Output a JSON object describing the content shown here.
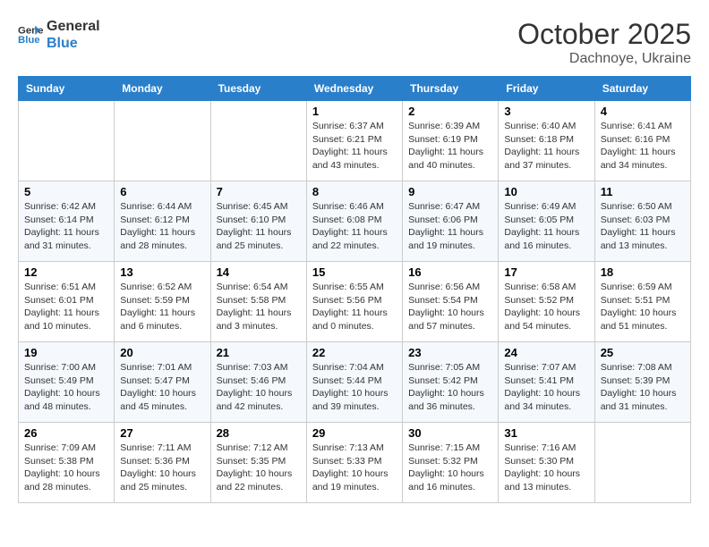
{
  "header": {
    "logo_line1": "General",
    "logo_line2": "Blue",
    "month": "October 2025",
    "location": "Dachnoye, Ukraine"
  },
  "weekdays": [
    "Sunday",
    "Monday",
    "Tuesday",
    "Wednesday",
    "Thursday",
    "Friday",
    "Saturday"
  ],
  "weeks": [
    [
      {
        "day": "",
        "info": ""
      },
      {
        "day": "",
        "info": ""
      },
      {
        "day": "",
        "info": ""
      },
      {
        "day": "1",
        "info": "Sunrise: 6:37 AM\nSunset: 6:21 PM\nDaylight: 11 hours\nand 43 minutes."
      },
      {
        "day": "2",
        "info": "Sunrise: 6:39 AM\nSunset: 6:19 PM\nDaylight: 11 hours\nand 40 minutes."
      },
      {
        "day": "3",
        "info": "Sunrise: 6:40 AM\nSunset: 6:18 PM\nDaylight: 11 hours\nand 37 minutes."
      },
      {
        "day": "4",
        "info": "Sunrise: 6:41 AM\nSunset: 6:16 PM\nDaylight: 11 hours\nand 34 minutes."
      }
    ],
    [
      {
        "day": "5",
        "info": "Sunrise: 6:42 AM\nSunset: 6:14 PM\nDaylight: 11 hours\nand 31 minutes."
      },
      {
        "day": "6",
        "info": "Sunrise: 6:44 AM\nSunset: 6:12 PM\nDaylight: 11 hours\nand 28 minutes."
      },
      {
        "day": "7",
        "info": "Sunrise: 6:45 AM\nSunset: 6:10 PM\nDaylight: 11 hours\nand 25 minutes."
      },
      {
        "day": "8",
        "info": "Sunrise: 6:46 AM\nSunset: 6:08 PM\nDaylight: 11 hours\nand 22 minutes."
      },
      {
        "day": "9",
        "info": "Sunrise: 6:47 AM\nSunset: 6:06 PM\nDaylight: 11 hours\nand 19 minutes."
      },
      {
        "day": "10",
        "info": "Sunrise: 6:49 AM\nSunset: 6:05 PM\nDaylight: 11 hours\nand 16 minutes."
      },
      {
        "day": "11",
        "info": "Sunrise: 6:50 AM\nSunset: 6:03 PM\nDaylight: 11 hours\nand 13 minutes."
      }
    ],
    [
      {
        "day": "12",
        "info": "Sunrise: 6:51 AM\nSunset: 6:01 PM\nDaylight: 11 hours\nand 10 minutes."
      },
      {
        "day": "13",
        "info": "Sunrise: 6:52 AM\nSunset: 5:59 PM\nDaylight: 11 hours\nand 6 minutes."
      },
      {
        "day": "14",
        "info": "Sunrise: 6:54 AM\nSunset: 5:58 PM\nDaylight: 11 hours\nand 3 minutes."
      },
      {
        "day": "15",
        "info": "Sunrise: 6:55 AM\nSunset: 5:56 PM\nDaylight: 11 hours\nand 0 minutes."
      },
      {
        "day": "16",
        "info": "Sunrise: 6:56 AM\nSunset: 5:54 PM\nDaylight: 10 hours\nand 57 minutes."
      },
      {
        "day": "17",
        "info": "Sunrise: 6:58 AM\nSunset: 5:52 PM\nDaylight: 10 hours\nand 54 minutes."
      },
      {
        "day": "18",
        "info": "Sunrise: 6:59 AM\nSunset: 5:51 PM\nDaylight: 10 hours\nand 51 minutes."
      }
    ],
    [
      {
        "day": "19",
        "info": "Sunrise: 7:00 AM\nSunset: 5:49 PM\nDaylight: 10 hours\nand 48 minutes."
      },
      {
        "day": "20",
        "info": "Sunrise: 7:01 AM\nSunset: 5:47 PM\nDaylight: 10 hours\nand 45 minutes."
      },
      {
        "day": "21",
        "info": "Sunrise: 7:03 AM\nSunset: 5:46 PM\nDaylight: 10 hours\nand 42 minutes."
      },
      {
        "day": "22",
        "info": "Sunrise: 7:04 AM\nSunset: 5:44 PM\nDaylight: 10 hours\nand 39 minutes."
      },
      {
        "day": "23",
        "info": "Sunrise: 7:05 AM\nSunset: 5:42 PM\nDaylight: 10 hours\nand 36 minutes."
      },
      {
        "day": "24",
        "info": "Sunrise: 7:07 AM\nSunset: 5:41 PM\nDaylight: 10 hours\nand 34 minutes."
      },
      {
        "day": "25",
        "info": "Sunrise: 7:08 AM\nSunset: 5:39 PM\nDaylight: 10 hours\nand 31 minutes."
      }
    ],
    [
      {
        "day": "26",
        "info": "Sunrise: 7:09 AM\nSunset: 5:38 PM\nDaylight: 10 hours\nand 28 minutes."
      },
      {
        "day": "27",
        "info": "Sunrise: 7:11 AM\nSunset: 5:36 PM\nDaylight: 10 hours\nand 25 minutes."
      },
      {
        "day": "28",
        "info": "Sunrise: 7:12 AM\nSunset: 5:35 PM\nDaylight: 10 hours\nand 22 minutes."
      },
      {
        "day": "29",
        "info": "Sunrise: 7:13 AM\nSunset: 5:33 PM\nDaylight: 10 hours\nand 19 minutes."
      },
      {
        "day": "30",
        "info": "Sunrise: 7:15 AM\nSunset: 5:32 PM\nDaylight: 10 hours\nand 16 minutes."
      },
      {
        "day": "31",
        "info": "Sunrise: 7:16 AM\nSunset: 5:30 PM\nDaylight: 10 hours\nand 13 minutes."
      },
      {
        "day": "",
        "info": ""
      }
    ]
  ]
}
